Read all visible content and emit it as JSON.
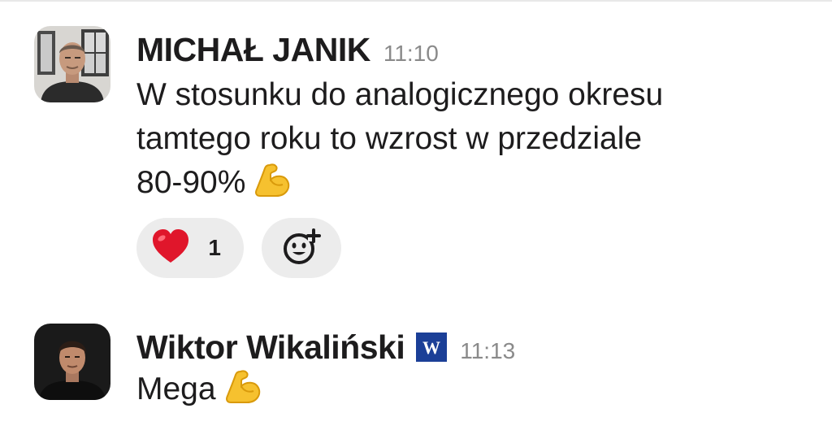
{
  "messages": [
    {
      "author": "MICHAŁ JANIK",
      "time": "11:10",
      "text_lines": [
        "W stosunku do analogicznego okresu",
        "tamtego roku to wzrost w przedziale",
        "80-90%"
      ],
      "text_emoji": "flexed-biceps",
      "reactions": [
        {
          "emoji": "red-heart",
          "count": "1"
        }
      ],
      "add_reaction_icon": "add-reaction-icon"
    },
    {
      "author": "Wiktor Wikaliński",
      "badge": "W",
      "time": "11:13",
      "text": "Mega",
      "text_emoji": "flexed-biceps"
    }
  ],
  "colors": {
    "author": "#1d1c1d",
    "time": "#8a8a8a",
    "reaction_bg": "#ececec",
    "badge_bg": "#1b3f97"
  }
}
